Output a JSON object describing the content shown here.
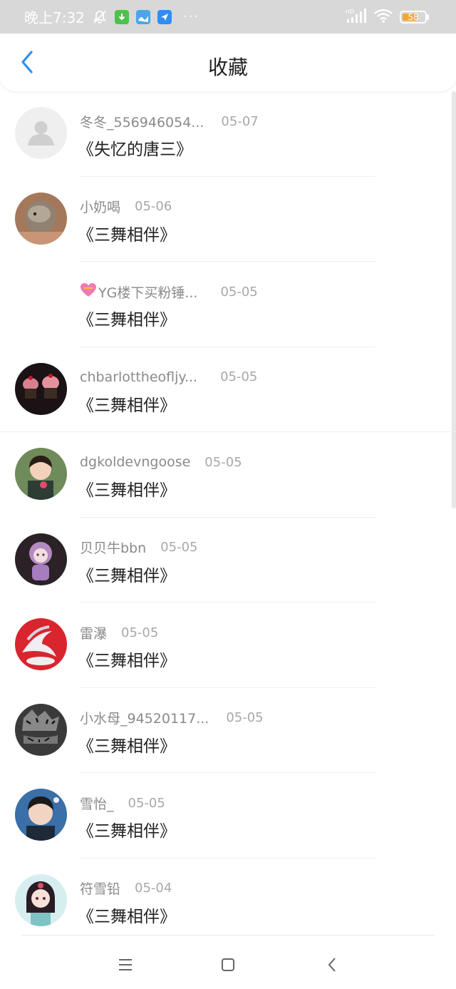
{
  "status_bar": {
    "time": "晚上7:32",
    "dots": "···",
    "battery_level": "58",
    "network": "HD"
  },
  "header": {
    "title": "收藏"
  },
  "colors": {
    "accent": "#2f8ef0",
    "name_text": "#8a8a8a",
    "date_text": "#a8a8a8",
    "title_text": "#222222"
  },
  "items": [
    {
      "name": "冬冬_556946054...",
      "date": "05-07",
      "title": "《失忆的唐三》",
      "avatar": "default-avatar-icon"
    },
    {
      "name": "小奶喝",
      "date": "05-06",
      "title": "《三舞相伴》",
      "avatar": "hamster-avatar"
    },
    {
      "name": "YG楼下买粉锤...",
      "date": "05-05",
      "title": "《三舞相伴》",
      "avatar": "none",
      "prefix_icon": "heart-icon"
    },
    {
      "name": "chbarlottheofljy...",
      "date": "05-05",
      "title": "《三舞相伴》",
      "avatar": "cupcake-avatar"
    },
    {
      "name": "dgkoldevngoose",
      "date": "05-05",
      "title": "《三舞相伴》",
      "avatar": "child-avatar"
    },
    {
      "name": "贝贝牛bbn",
      "date": "05-05",
      "title": "《三舞相伴》",
      "avatar": "anime-purple-avatar"
    },
    {
      "name": "雷瀑",
      "date": "05-05",
      "title": "《三舞相伴》",
      "avatar": "pegasus-avatar"
    },
    {
      "name": "小水母_94520117...",
      "date": "05-05",
      "title": "《三舞相伴》",
      "avatar": "tiger-avatar"
    },
    {
      "name": "雪怡_",
      "date": "05-05",
      "title": "《三舞相伴》",
      "avatar": "person-avatar"
    },
    {
      "name": "符雪铅",
      "date": "05-04",
      "title": "《三舞相伴》",
      "avatar": "anime-girl-avatar"
    }
  ]
}
